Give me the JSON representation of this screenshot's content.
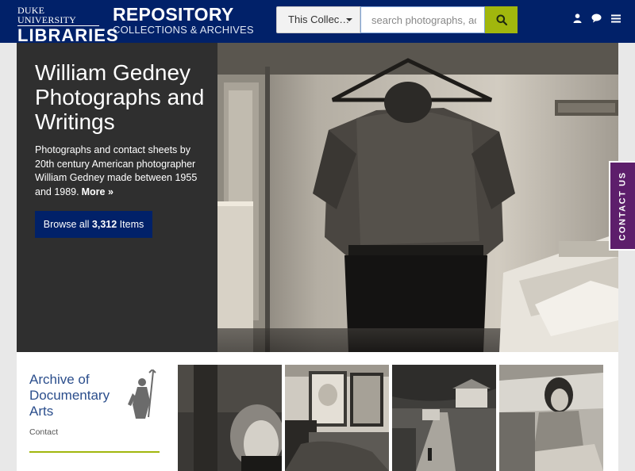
{
  "header": {
    "logo_top": "DUKE UNIVERSITY",
    "logo_bottom": "LIBRARIES",
    "site_title": "REPOSITORY",
    "site_subtitle": "COLLECTIONS & ARCHIVES",
    "scope_label": "This Collec…",
    "search_placeholder": "search photographs, adv",
    "icons": [
      "search-icon",
      "user-icon",
      "chat-icon",
      "menu-icon"
    ]
  },
  "hero": {
    "title": "William Gedney Photographs and Writings",
    "description": "Photographs and contact sheets by 20th century American photographer William Gedney made between 1955 and 1989.",
    "more_label": "More »",
    "browse_prefix": "Browse all",
    "browse_count": "3,312",
    "browse_suffix": "Items"
  },
  "contact_tab": {
    "label": "CONTACT US"
  },
  "archive": {
    "name": "Archive of Documentary Arts",
    "contact_label": "Contact"
  },
  "thumbnails": [
    "thumbnail-photo-1",
    "thumbnail-photo-2",
    "thumbnail-photo-3",
    "thumbnail-photo-4"
  ],
  "colors": {
    "header_bg": "#012169",
    "search_button": "#a1b70d",
    "contact_tab": "#5d1e6b",
    "accent_rule": "#a1b70d",
    "archive_link": "#2b4e8c"
  }
}
